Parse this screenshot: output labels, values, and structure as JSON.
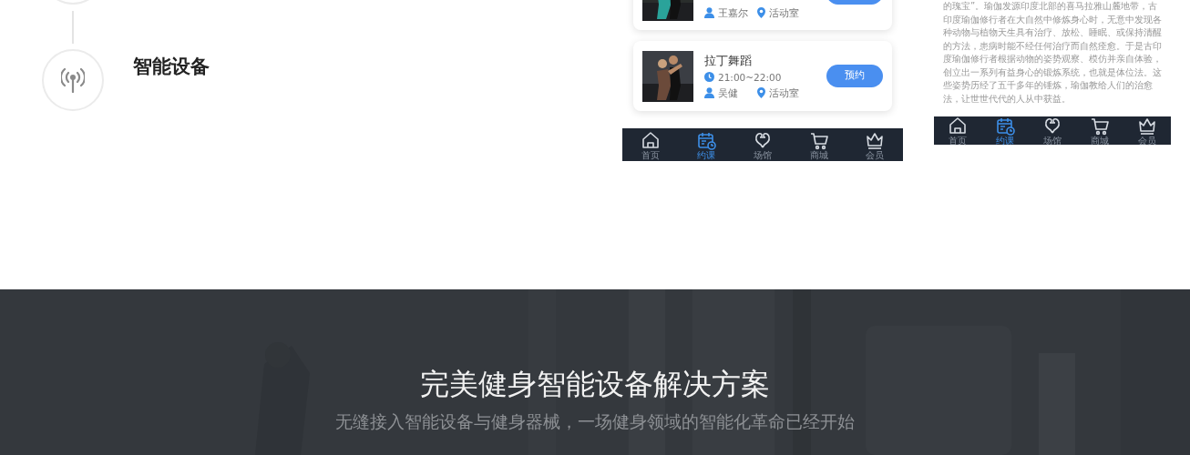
{
  "timeline": {
    "items": [
      {
        "title": "智能设备"
      }
    ]
  },
  "phone_schedule": {
    "cards": [
      {
        "teacher": "王嘉尔",
        "room": "活动室"
      },
      {
        "title": "拉丁舞蹈",
        "time": "21:00~22:00",
        "teacher": "吴健",
        "room": "活动室",
        "button": "预约"
      }
    ],
    "tabs": [
      {
        "label": "首页",
        "selected": false
      },
      {
        "label": "约课",
        "selected": true
      },
      {
        "label": "场馆",
        "selected": false
      },
      {
        "label": "商城",
        "selected": false
      },
      {
        "label": "会员",
        "selected": false
      }
    ]
  },
  "phone_detail": {
    "text": "的瑰宝”。瑜伽发源印度北部的喜马拉雅山麓地带，古印度瑜伽修行者在大自然中修炼身心时，无意中发现各种动物与植物天生具有治疗、放松、睡眠、或保持清醒的方法，患病时能不经任何治疗而自然痊愈。于是古印度瑜伽修行者根据动物的姿势观察、模仿并亲自体验，创立出一系列有益身心的锻炼系统，也就是体位法。这些姿势历经了五千多年的锤炼，瑜伽教给人们的治愈法，让世世代代的人从中获益。",
    "tabs": [
      {
        "label": "首页",
        "selected": false
      },
      {
        "label": "约课",
        "selected": true
      },
      {
        "label": "场馆",
        "selected": false
      },
      {
        "label": "商城",
        "selected": false
      },
      {
        "label": "会员",
        "selected": false
      }
    ]
  },
  "banner": {
    "title": "完美健身智能设备解决方案",
    "subtitle": "无缝接入智能设备与健身器械，一场健身领域的智能化革命已经开始"
  }
}
